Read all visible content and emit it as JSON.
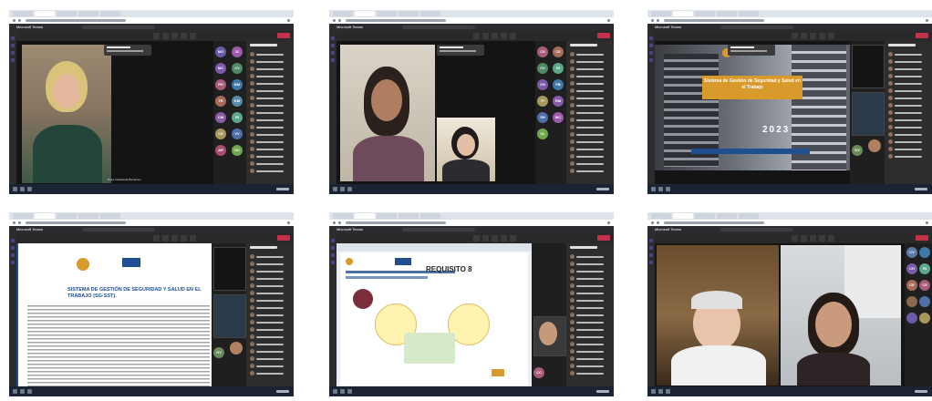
{
  "screenshots": [
    {
      "app_title": "Microsoft Teams",
      "panel_title": "Participantes",
      "speaker_name": "Rosa Castañeda Barrantes",
      "participant_initials": [
        "MO",
        "JC",
        "MC",
        "CV",
        "PH",
        "BM",
        "TR",
        "KM",
        "CM",
        "RI",
        "CE",
        "VV",
        "AR",
        "DC"
      ]
    },
    {
      "app_title": "Microsoft Teams",
      "panel_title": "Participantes",
      "participant_initials": [
        "CS",
        "CE",
        "CV",
        "RI",
        "CH",
        "FB",
        "FI",
        "RM",
        "SH",
        "MC",
        "CL"
      ]
    },
    {
      "app_title": "Microsoft Teams",
      "panel_title": "Participantes",
      "slide": {
        "title": "Sistema de Gestión de Seguridad y Salud en el Trabajo",
        "year": "2023"
      },
      "participant_initials": [
        "GV"
      ]
    },
    {
      "app_title": "Microsoft Teams",
      "panel_title": "Participantes",
      "slide": {
        "header": "SISTEMA DE GESTIÓN DE SEGURIDAD Y SALUD EN EL TRABAJO (SG-SST)."
      },
      "participant_initials": [
        "GV"
      ]
    },
    {
      "app_title": "Microsoft Teams",
      "panel_title": "Participantes",
      "slide": {
        "heading": "REQUISITO 8"
      },
      "participant_initials": [
        "CC"
      ]
    },
    {
      "app_title": "Microsoft Teams",
      "panel_title": "Participantes",
      "participant_initials": [
        "CV",
        "CH",
        "RI",
        "CE",
        "CS"
      ]
    }
  ],
  "colors": {
    "teams_purple": "#5b5fc7",
    "leave_red": "#c4314b",
    "slide_gold": "#d89a2a",
    "slide_blue": "#1f4e91"
  }
}
